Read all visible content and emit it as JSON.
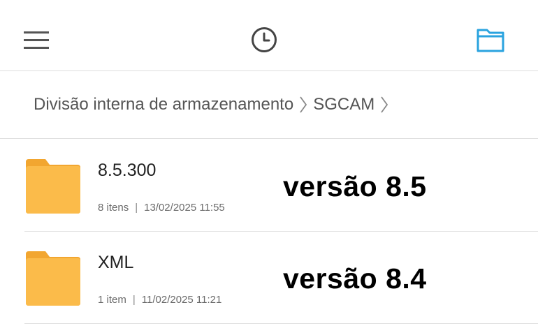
{
  "colors": {
    "accent": "#2aa3df",
    "folder": "#fbbb4a",
    "folder_tab": "#f2a630"
  },
  "header": {
    "menu_icon": "hamburger-menu-icon",
    "history_icon": "clock-icon",
    "folders_icon": "folder-outline-icon"
  },
  "breadcrumb": [
    {
      "label": "Divisão interna de armazenamento"
    },
    {
      "label": "SGCAM"
    }
  ],
  "items": [
    {
      "name": "8.5.300",
      "count": "8 itens",
      "date": "13/02/2025 11:55",
      "annotation": "versão 8.5"
    },
    {
      "name": "XML",
      "count": "1 item",
      "date": "11/02/2025 11:21",
      "annotation": "versão 8.4"
    }
  ]
}
